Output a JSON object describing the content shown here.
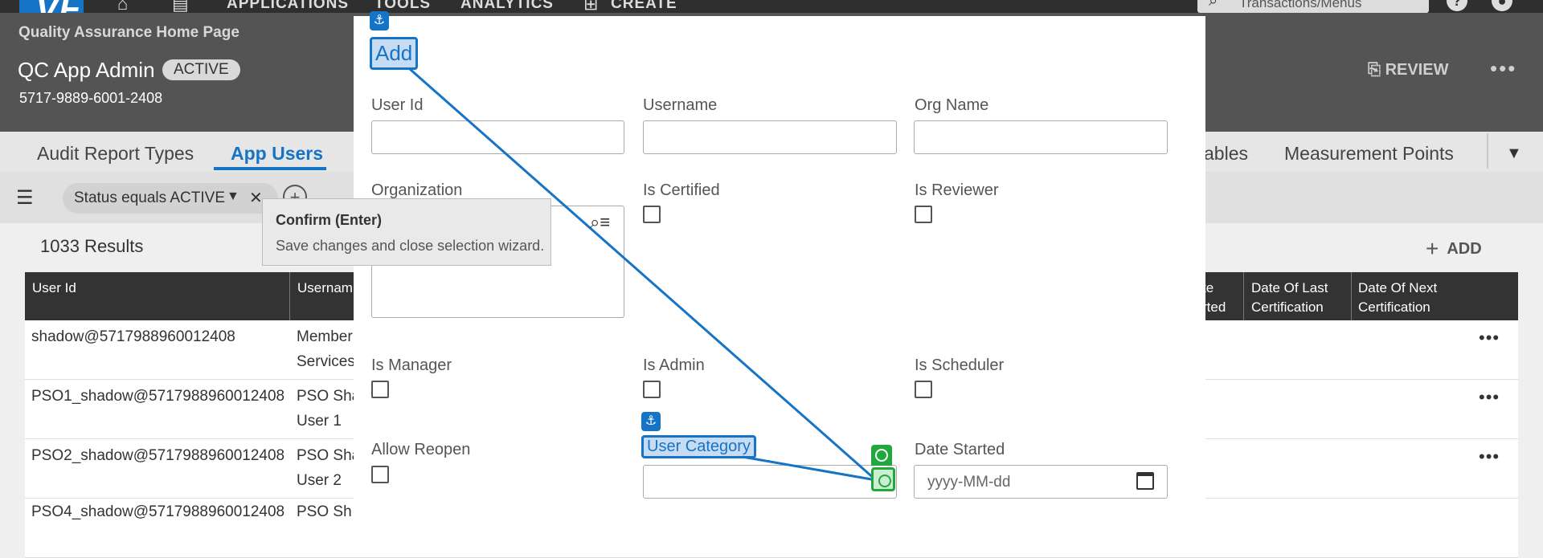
{
  "topnav": {
    "logo_text": "VF",
    "items": [
      "APPLICATIONS",
      "TOOLS",
      "ANALYTICS",
      "CREATE"
    ],
    "search_placeholder": "Transactions/Menus",
    "help_glyph": "?"
  },
  "header": {
    "subtitle": "Quality Assurance Home Page",
    "title": "QC App Admin",
    "status_badge": "ACTIVE",
    "id": "5717-9889-6001-2408",
    "review_label": "REVIEW",
    "more_glyph": "•••"
  },
  "tabs": {
    "items": [
      "Audit Report Types",
      "App Users",
      "ables",
      "Measurement Points"
    ],
    "active": "App Users"
  },
  "filters": {
    "chip_label": "Status equals ACTIVE"
  },
  "results": {
    "count_label": "1033 Results",
    "add_label": "ADD",
    "columns": [
      "User Id",
      "Usernam",
      "te\nrted",
      "Date Of Last\nCertification",
      "Date Of Next\nCertification"
    ],
    "rows": [
      {
        "user_id": "shadow@5717988960012408",
        "username": "Member\nServices"
      },
      {
        "user_id": "PSO1_shadow@5717988960012408",
        "username": "PSO Sha\nUser 1"
      },
      {
        "user_id": "PSO2_shadow@5717988960012408",
        "username": "PSO Sha\nUser 2"
      },
      {
        "user_id": "PSO4_shadow@5717988960012408",
        "username": "PSO Sh"
      }
    ]
  },
  "tooltip": {
    "title": "Confirm (Enter)",
    "text": "Save changes and close selection wizard."
  },
  "modal": {
    "title": "Add",
    "anchor_glyph": "⚓",
    "fields": {
      "user_id": "User Id",
      "username": "Username",
      "org_name": "Org Name",
      "organization": "Organization",
      "is_certified": "Is Certified",
      "is_reviewer": "Is Reviewer",
      "is_manager": "Is Manager",
      "is_admin": "Is Admin",
      "is_scheduler": "Is Scheduler",
      "allow_reopen": "Allow Reopen",
      "user_category": "User Category",
      "date_started": "Date Started"
    },
    "date_placeholder": "yyyy-MM-dd"
  },
  "colors": {
    "accent": "#1674c6",
    "target_green": "#20a83e",
    "header_bg": "#545454",
    "nav_bg": "#2f2f2f"
  }
}
